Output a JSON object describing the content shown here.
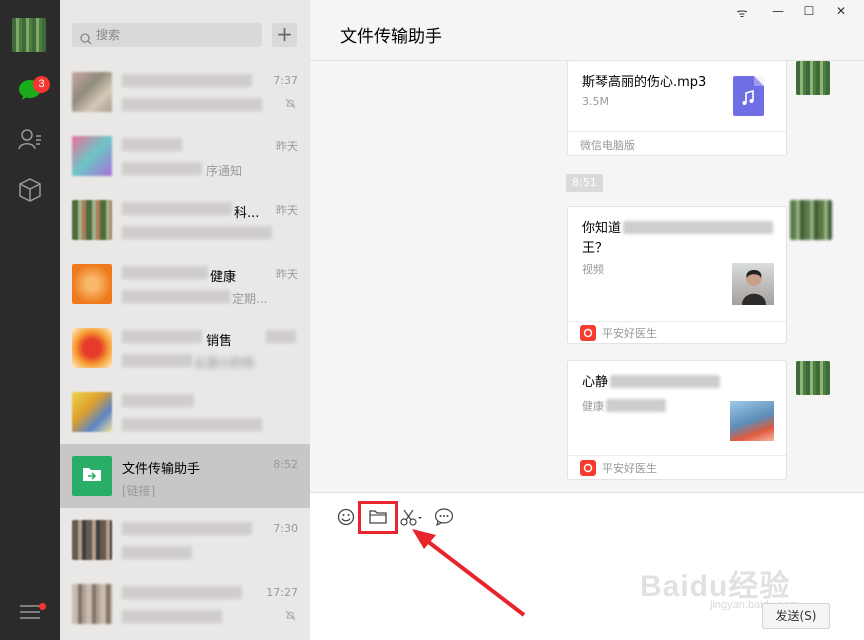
{
  "search": {
    "placeholder": "搜索"
  },
  "nav": {
    "badge": "3"
  },
  "chats": [
    {
      "name": "",
      "sub": "",
      "time": "7:37"
    },
    {
      "name": "",
      "sub": "序通知",
      "time": "昨天"
    },
    {
      "name": "",
      "sub": "",
      "time": "昨天",
      "name_tail": "科..."
    },
    {
      "name": "",
      "sub": "定期...",
      "time": "昨天",
      "name_tail": "健康"
    },
    {
      "name": "",
      "sub": "云游小的场",
      "time": "",
      "name_tail": "销售"
    },
    {
      "name": "",
      "sub": "",
      "time": ""
    },
    {
      "name": "文件传输助手",
      "sub": "[链接]",
      "time": "8:52"
    },
    {
      "name": "",
      "sub": "",
      "time": "7:30"
    },
    {
      "name": "",
      "sub": "",
      "time": "17:27"
    }
  ],
  "header": {
    "title": "文件传输助手",
    "window_controls": [
      "ᯤ",
      "—",
      "☐",
      "✕"
    ]
  },
  "messages": {
    "file": {
      "name": "斯琴高丽的伤心.mp3",
      "size": "3.5M",
      "source": "微信电脑版"
    },
    "time_chip": "8:51",
    "link1": {
      "title_a": "你知道",
      "title_b": "王？",
      "sub": "视频",
      "source": "平安好医生"
    },
    "link2": {
      "title": "心静",
      "sub": "健康",
      "source": "平安好医生"
    }
  },
  "composer": {
    "send_label": "发送(S)"
  },
  "watermark": {
    "main": "Baidu经验",
    "sub": "jingyan.baidu.com"
  },
  "colors": {
    "accent_red": "#e8242c",
    "badge_red": "#f43530",
    "file_green": "#2aae67",
    "music_purple": "#6f6ee4"
  }
}
